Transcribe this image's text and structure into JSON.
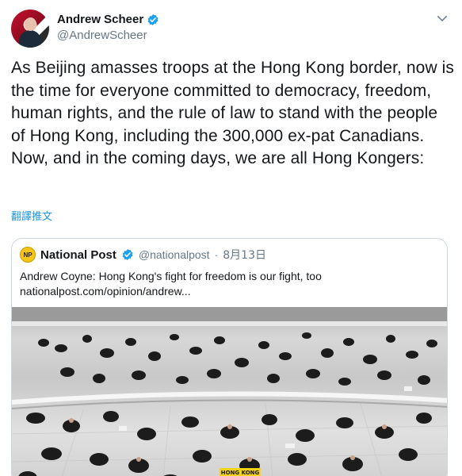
{
  "author": {
    "display_name": "Andrew Scheer",
    "handle": "@AndrewScheer",
    "verified": true
  },
  "tweet": {
    "text": "As Beijing amasses troops at the Hong Kong border, now is the time for everyone committed to democracy, freedom, human rights, and the rule of law to stand with the people of Hong Kong, including the 300,000 ex-pat Canadians. Now, and in the coming days, we are all Hong Kongers:",
    "translate_label": "翻譯推文"
  },
  "quoted_tweet": {
    "logo_text": "NP",
    "display_name": "National Post",
    "handle": "@nationalpost",
    "separator": "·",
    "date": "8月13日",
    "text": "Andrew Coyne: Hong Kong's fight for freedom is our fight, too nationalpost.com/opinion/andrew...",
    "image_sign_text": "HONG KONG"
  },
  "icons": {
    "verified": "verified-badge-icon",
    "menu": "chevron-down-icon"
  },
  "colors": {
    "accent": "#1da1f2",
    "link": "#1b95e0",
    "secondary_text": "#657786",
    "border": "#ccd6dd"
  }
}
